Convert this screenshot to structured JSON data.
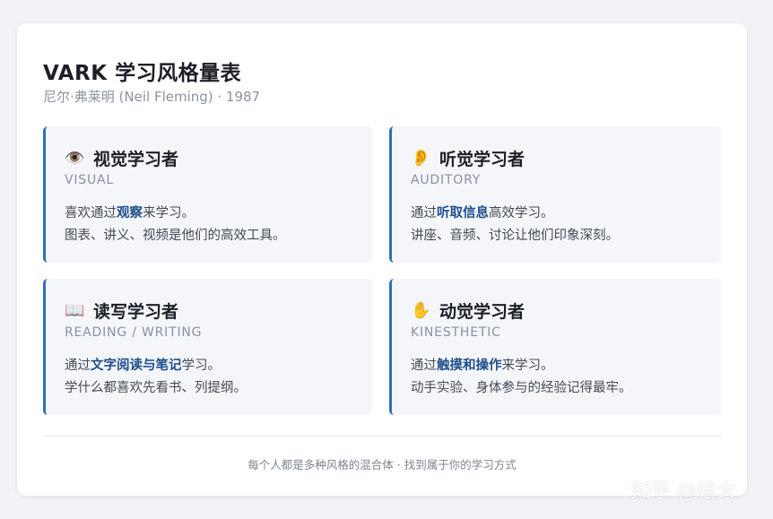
{
  "header": {
    "title": "VARK 学习风格量表",
    "subtitle": "尼尔·弗莱明 (Neil Fleming) · 1987"
  },
  "cards": [
    {
      "icon": "eye-icon",
      "glyph": "👁️",
      "title": "视觉学习者",
      "subtitle": "VISUAL",
      "line1_pre": "喜欢通过",
      "line1_highlight": "观察",
      "line1_post": "来学习。",
      "line2": "图表、讲义、视频是他们的高效工具。"
    },
    {
      "icon": "ear-icon",
      "glyph": "👂",
      "title": "听觉学习者",
      "subtitle": "AUDITORY",
      "line1_pre": "通过",
      "line1_highlight": "听取信息",
      "line1_post": "高效学习。",
      "line2": "讲座、音频、讨论让他们印象深刻。"
    },
    {
      "icon": "book-icon",
      "glyph": "📖",
      "title": "读写学习者",
      "subtitle": "READING / WRITING",
      "line1_pre": "通过",
      "line1_highlight": "文字阅读与笔记",
      "line1_post": "学习。",
      "line2": "学什么都喜欢先看书、列提纲。"
    },
    {
      "icon": "hand-icon",
      "glyph": "✋",
      "title": "动觉学习者",
      "subtitle": "KINESTHETIC",
      "line1_pre": "通过",
      "line1_highlight": "触摸和操作",
      "line1_post": "来学习。",
      "line2": "动手实验、身体参与的经验记得最牢。"
    }
  ],
  "footer": "每个人都是多种风格的混合体 · 找到属于你的学习方式",
  "watermark": "知乎 @桔大",
  "colors": {
    "accent": "#2f6fb5",
    "highlight": "#1f4f8c",
    "card_bg": "#f4f6f9"
  }
}
